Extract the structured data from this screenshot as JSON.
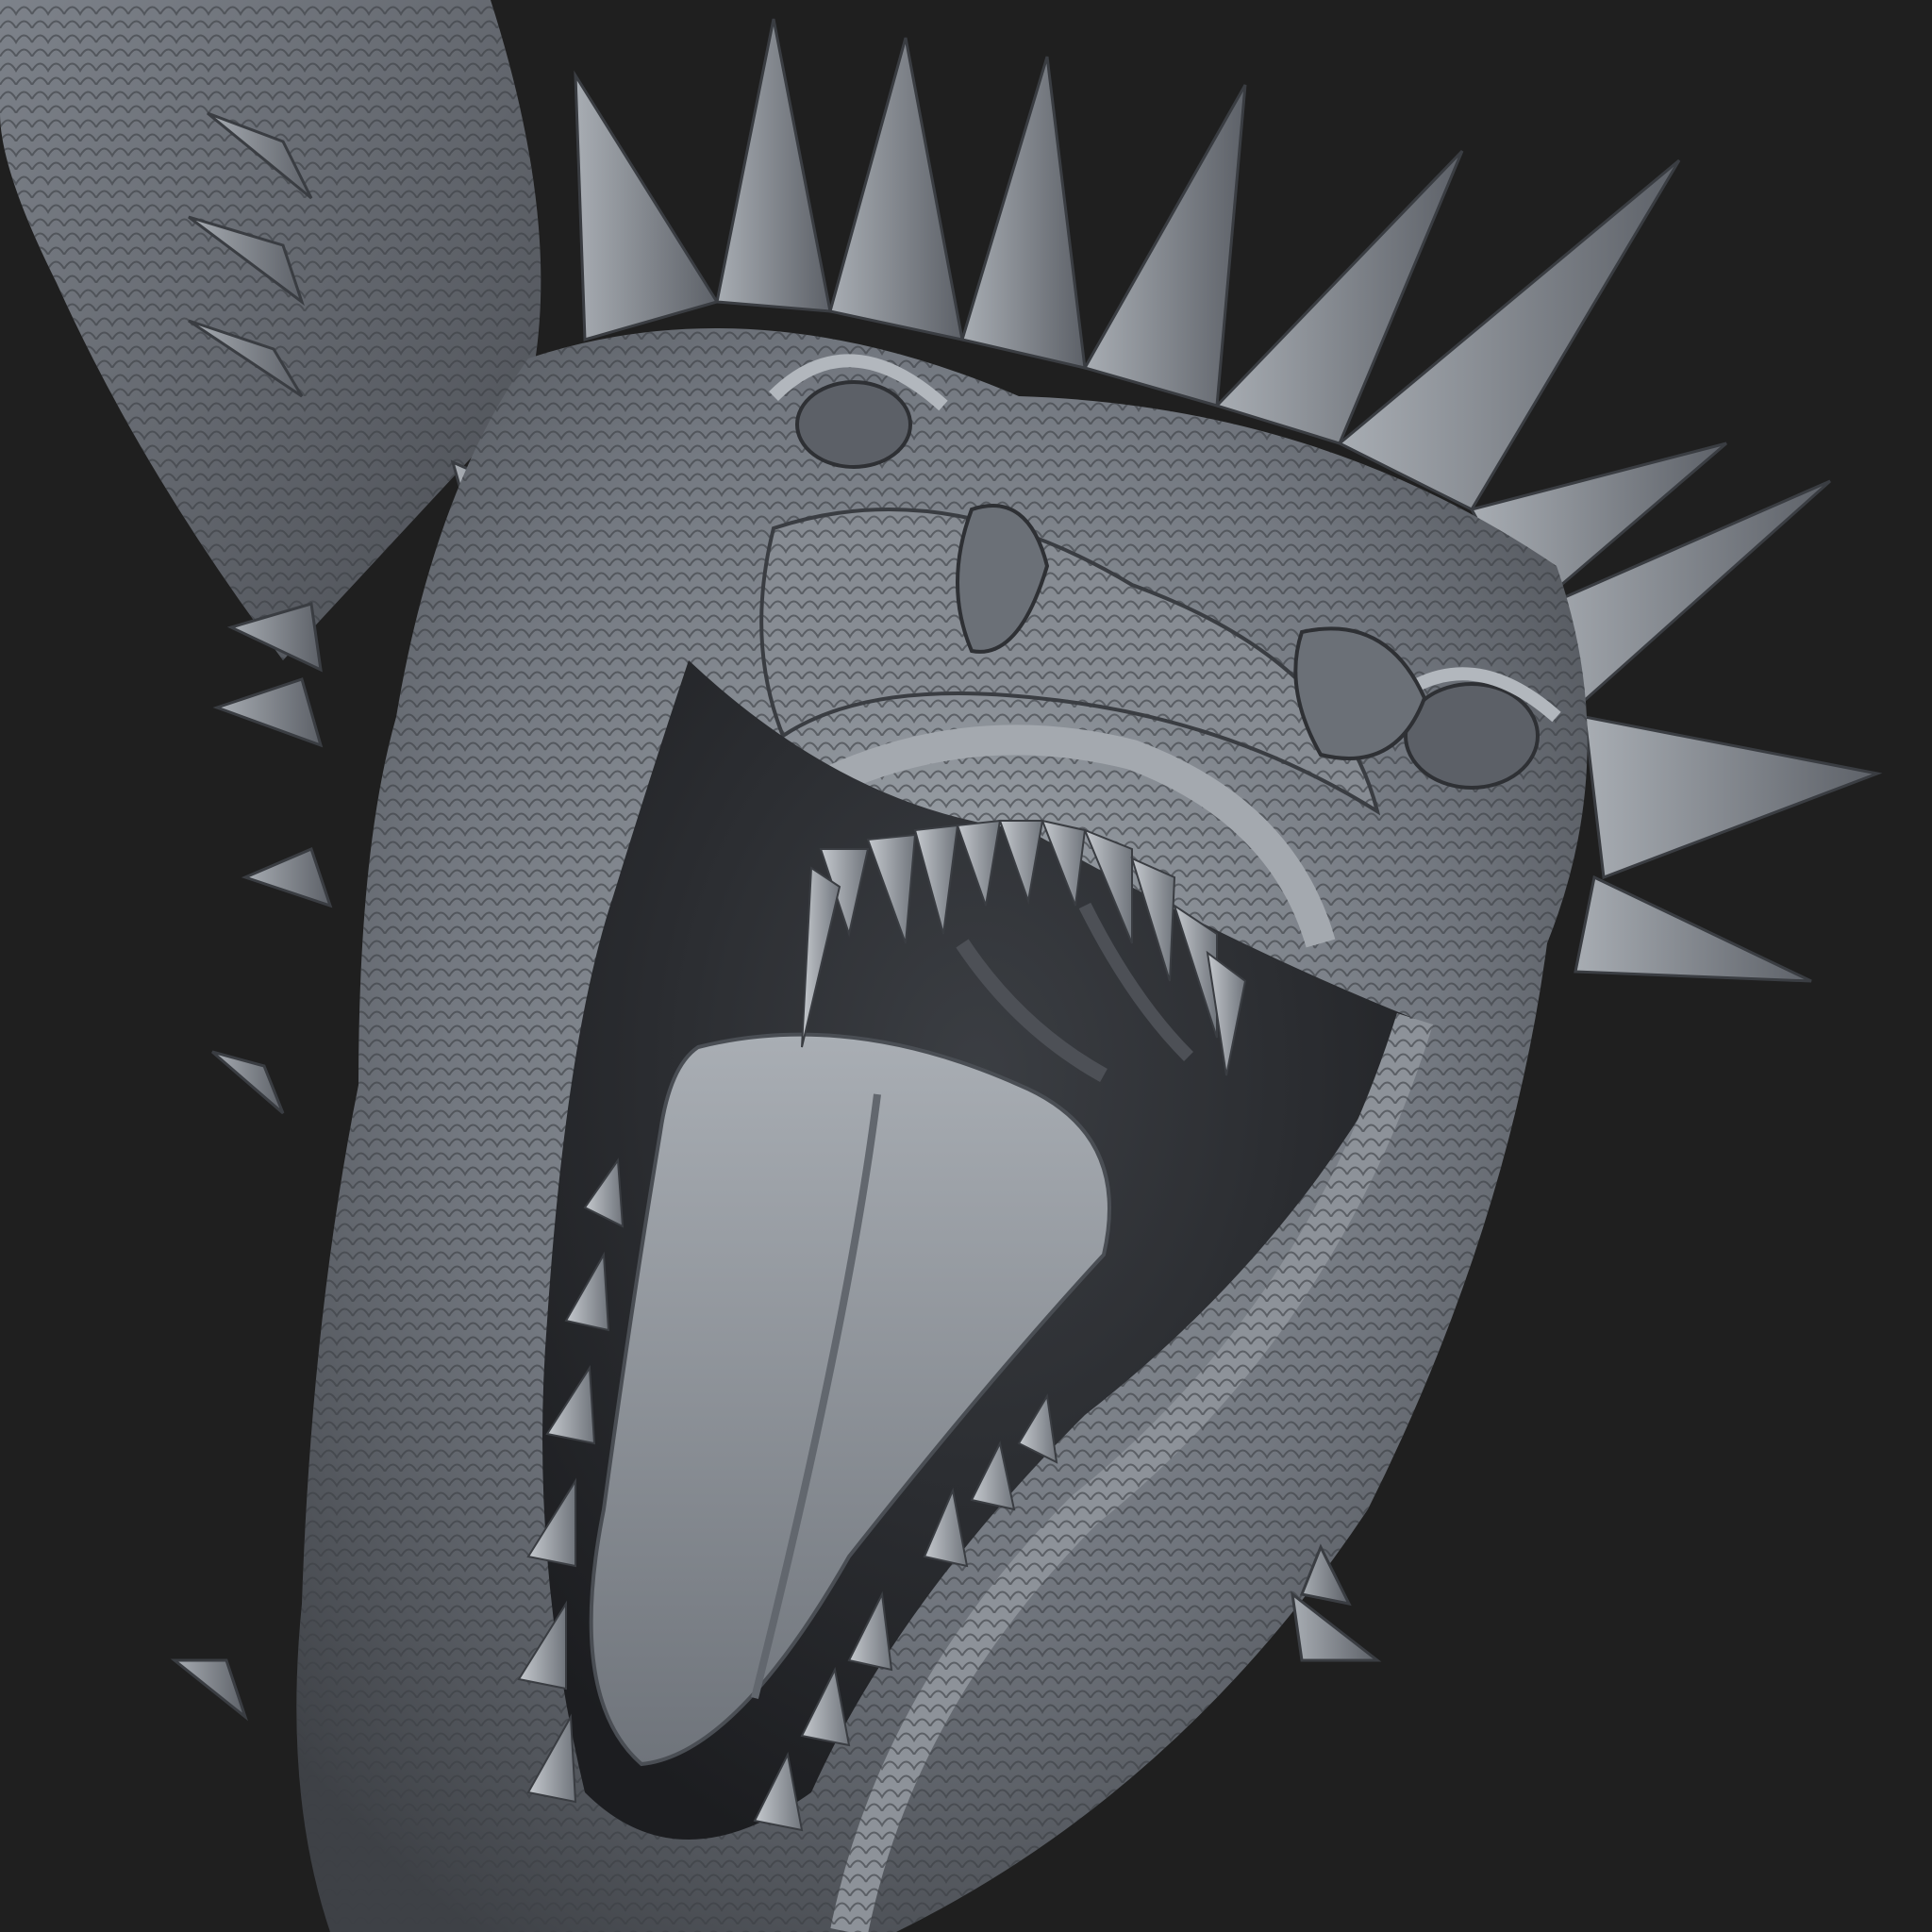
{
  "scene": {
    "subject": "dragon-head",
    "background_color": "#1f1f1f",
    "material_light": "#9aa0a6",
    "material_mid": "#6e737a",
    "material_dark": "#3d4045",
    "mouth_shadow": "#2a2c30",
    "tongue_color": "#8e949b"
  }
}
